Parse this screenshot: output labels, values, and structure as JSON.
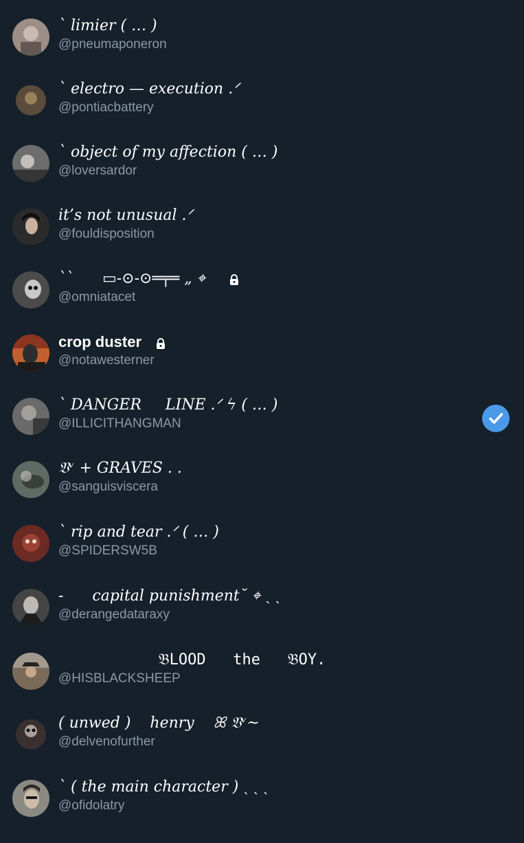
{
  "accounts": [
    {
      "name": "` limier ( … )",
      "handle": "@pneumaponeron",
      "avatar_color": "#9d8e86",
      "locked": false,
      "selected": false
    },
    {
      "name": "` electro — execution .ᐟ",
      "handle": "@pontiacbattery",
      "avatar_color": "#5a4b3a",
      "locked": false,
      "selected": false
    },
    {
      "name": "` object of my affection ( … )",
      "handle": "@loversardor",
      "avatar_color": "#6d6d6d",
      "locked": false,
      "selected": false
    },
    {
      "name": "it’s not unusual .ᐟ",
      "handle": "@fouldisposition",
      "avatar_color": "#2b2b2b",
      "locked": false,
      "selected": false
    },
    {
      "name": "``      ▭-⊙-⊙═╤═ „ ⌖",
      "handle": "@omniatacet",
      "avatar_color": "#4b4b4b",
      "locked": true,
      "selected": false
    },
    {
      "name": "crop duster",
      "handle": "@notawesterner",
      "avatar_color": "#c1602f",
      "locked": true,
      "selected": false
    },
    {
      "name": "` DANGER     LINE .ᐟ ϟ ( … )",
      "handle": "@ILLICITHANGMAN",
      "avatar_color": "#6a6a6a",
      "locked": false,
      "selected": true
    },
    {
      "name": "𝔙ᵛ + GRAVES . .",
      "handle": "@sanguisviscera",
      "avatar_color": "#5e6a63",
      "locked": false,
      "selected": false
    },
    {
      "name": "` rip and tear .ᐟ ( … )",
      "handle": "@SPIDERSW5B",
      "avatar_color": "#6b2a22",
      "locked": false,
      "selected": false
    },
    {
      "name": "-      capital punishment˘ ⌖ ˎ ˎ",
      "handle": "@derangedataraxy",
      "avatar_color": "#444444",
      "locked": false,
      "selected": false
    },
    {
      "name": "           𝔅LOOD   the   𝔅OY.",
      "handle": "@HISBLACKSHEEP",
      "avatar_color": "#7a6a58",
      "locked": false,
      "selected": false
    },
    {
      "name": "( unwed )    henry    ꕤ 𝔙ᵛ~",
      "handle": "@delvenofurther",
      "avatar_color": "#3a3030",
      "locked": false,
      "selected": false
    },
    {
      "name": "` ( the main character ) ˎ ˎ ˎ",
      "handle": "@ofidolatry",
      "avatar_color": "#8a8a82",
      "locked": false,
      "selected": false
    }
  ],
  "icons": {
    "lock": "lock-icon",
    "verified_check": "check-circle-icon"
  },
  "colors": {
    "background": "#15202b",
    "handle_text": "#8b98a5",
    "accent": "#4a99e9"
  }
}
